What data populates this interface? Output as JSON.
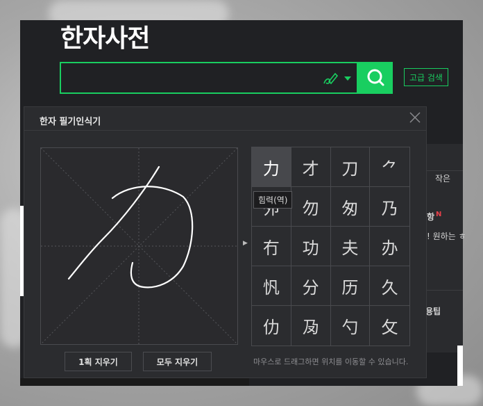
{
  "dictionary": {
    "title": "한자사전",
    "search": {
      "value": "",
      "placeholder": ""
    },
    "advanced_search_label": "고급 검색",
    "side": {
      "tab_label": "작은",
      "notice_label": "항",
      "notice_badge": "N",
      "notice_text": "! 원하는 ㅎ",
      "tip_label": "용팁"
    }
  },
  "handwriting": {
    "title": "한자 필기인식기",
    "tooltip": "힘력(역)",
    "candidates": [
      "力",
      "才",
      "刀",
      "⺈",
      "夘",
      "勿",
      "匆",
      "乃",
      "冇",
      "功",
      "夫",
      "办",
      "忛",
      "分",
      "历",
      "久",
      "仂",
      "夃",
      "勺",
      "攵"
    ],
    "clear_one_label": "1획 지우기",
    "clear_all_label": "모두 지우기",
    "hint": "마우스로 드래그하면 위치를 이동할 수 있습니다."
  },
  "colors": {
    "accent": "#19ce60",
    "panel": "#202124",
    "popup": "#2b2c2f",
    "badge": "#e8404a"
  }
}
